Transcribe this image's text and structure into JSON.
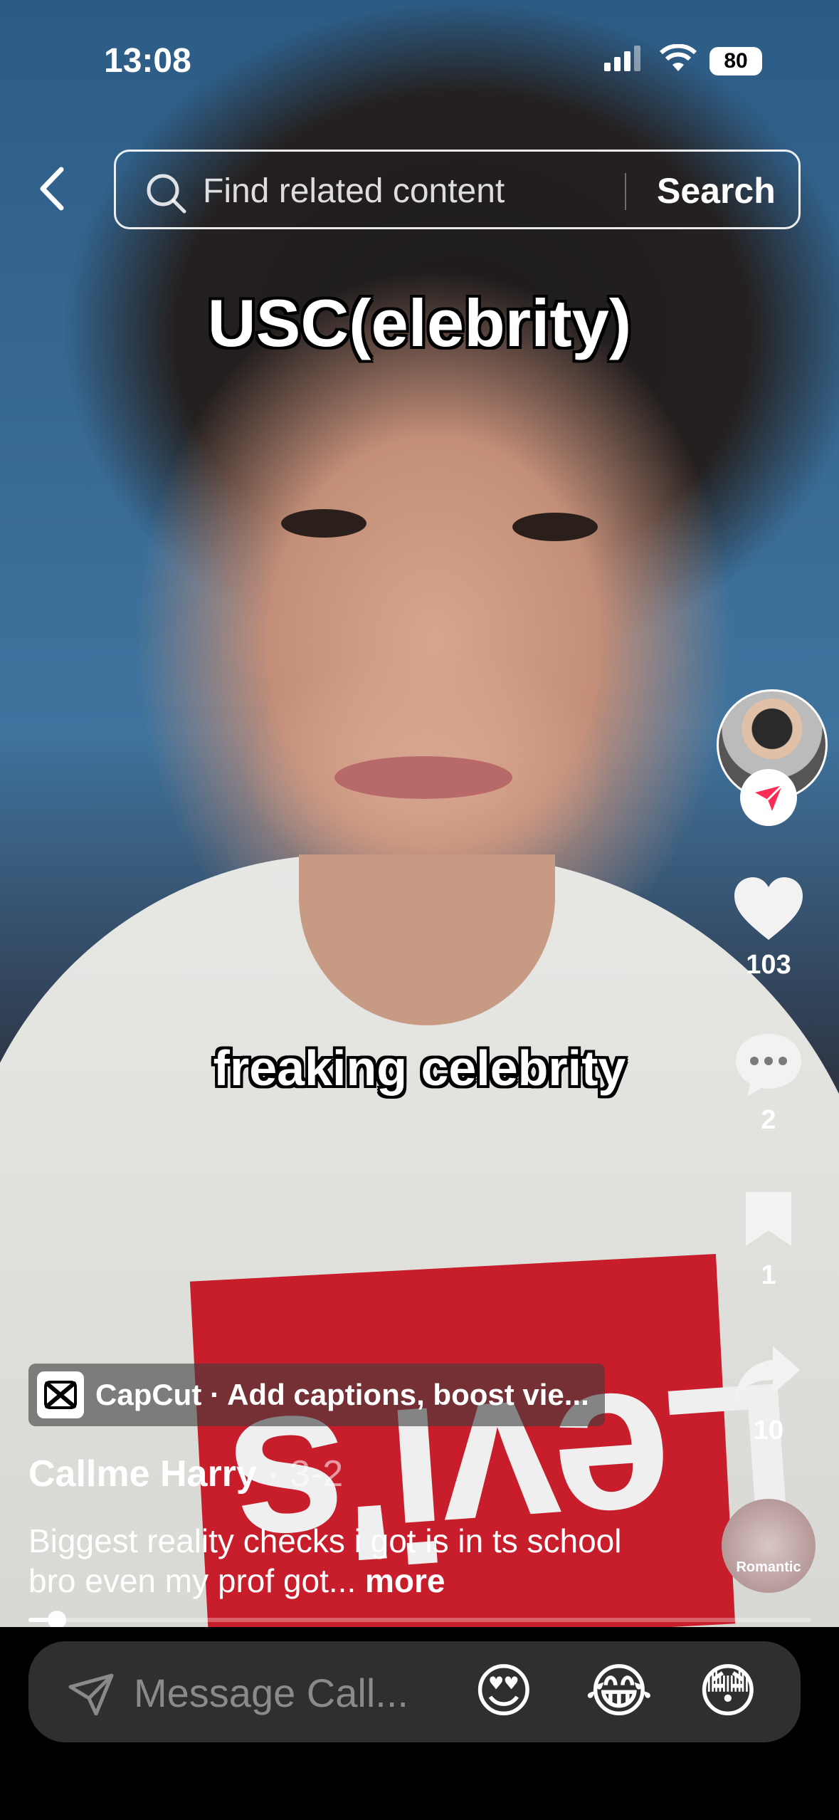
{
  "status_bar": {
    "time": "13:08",
    "battery": "80"
  },
  "search": {
    "placeholder": "Find related content",
    "button_label": "Search"
  },
  "video": {
    "caption_top": "USC(elebrity)",
    "caption_mid": "freaking celebrity",
    "shirt_logo": "Levi's"
  },
  "actions": {
    "likes": "103",
    "comments": "2",
    "saves": "1",
    "shares": "10",
    "music_label": "Romantic"
  },
  "post": {
    "promo": "CapCut · Add captions, boost vie...",
    "author": "Callme Harry",
    "date": "3-2",
    "description": "Biggest reality checks i got is in ts school bro even my prof got...",
    "more": "more",
    "progress": 0.03
  },
  "message_bar": {
    "placeholder": "Message Call...",
    "emojis": [
      "😍",
      "😂",
      "😳"
    ]
  },
  "colors": {
    "accent_red": "#fe2c55",
    "bar_bg": "#2f2f2f"
  }
}
